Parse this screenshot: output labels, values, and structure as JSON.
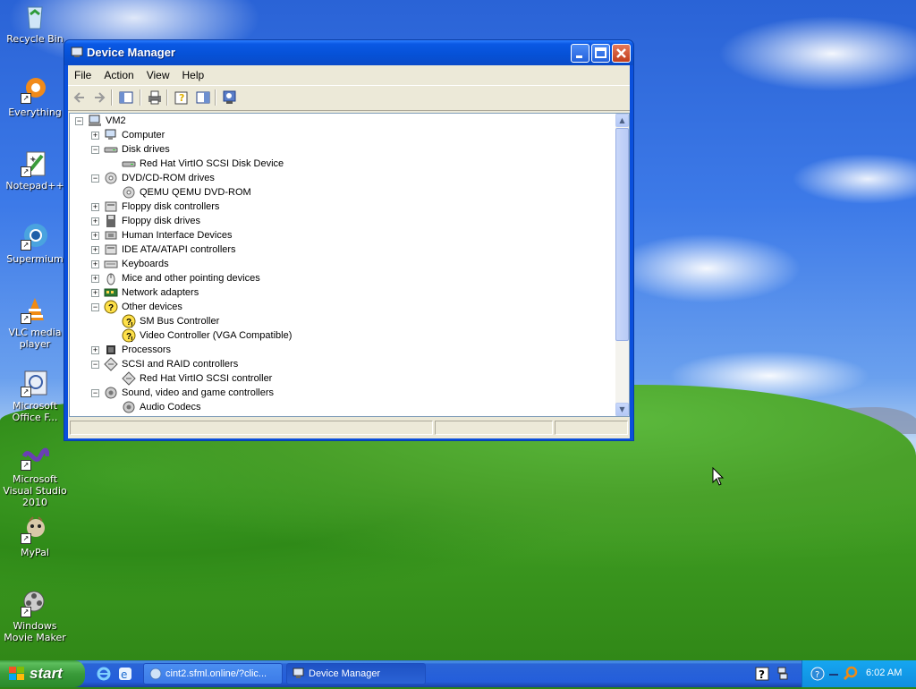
{
  "desktop": {
    "icons": [
      {
        "label": "Recycle Bin",
        "icon": "recycle-bin-icon"
      },
      {
        "label": "Everything",
        "icon": "everything-icon"
      },
      {
        "label": "Notepad++",
        "icon": "notepadpp-icon"
      },
      {
        "label": "Supermium",
        "icon": "supermium-icon"
      },
      {
        "label": "VLC media player",
        "icon": "vlc-icon"
      },
      {
        "label": "Microsoft Office F...",
        "icon": "office-icon"
      },
      {
        "label": "Microsoft Visual Studio 2010",
        "icon": "visual-studio-icon"
      },
      {
        "label": "MyPal",
        "icon": "mypal-icon"
      },
      {
        "label": "Windows Movie Maker",
        "icon": "movie-maker-icon"
      }
    ]
  },
  "window": {
    "title": "Device Manager",
    "menu": [
      "File",
      "Action",
      "View",
      "Help"
    ],
    "toolbar": [
      "back",
      "forward",
      "show-hide-console-tree",
      "print",
      "properties",
      "help",
      "scan-hardware"
    ],
    "tree": {
      "root": "VM2",
      "items": [
        {
          "label": "Computer",
          "expander": "+",
          "level": 1,
          "icon": "computer-icon"
        },
        {
          "label": "Disk drives",
          "expander": "-",
          "level": 1,
          "icon": "disk-drive-icon"
        },
        {
          "label": "Red Hat VirtIO SCSI Disk Device",
          "expander": "",
          "level": 2,
          "icon": "disk-drive-icon"
        },
        {
          "label": "DVD/CD-ROM drives",
          "expander": "-",
          "level": 1,
          "icon": "cdrom-icon"
        },
        {
          "label": "QEMU QEMU DVD-ROM",
          "expander": "",
          "level": 2,
          "icon": "cdrom-icon"
        },
        {
          "label": "Floppy disk controllers",
          "expander": "+",
          "level": 1,
          "icon": "controller-icon"
        },
        {
          "label": "Floppy disk drives",
          "expander": "+",
          "level": 1,
          "icon": "floppy-icon"
        },
        {
          "label": "Human Interface Devices",
          "expander": "+",
          "level": 1,
          "icon": "hid-icon"
        },
        {
          "label": "IDE ATA/ATAPI controllers",
          "expander": "+",
          "level": 1,
          "icon": "controller-icon"
        },
        {
          "label": "Keyboards",
          "expander": "+",
          "level": 1,
          "icon": "keyboard-icon"
        },
        {
          "label": "Mice and other pointing devices",
          "expander": "+",
          "level": 1,
          "icon": "mouse-icon"
        },
        {
          "label": "Network adapters",
          "expander": "+",
          "level": 1,
          "icon": "network-adapter-icon"
        },
        {
          "label": "Other devices",
          "expander": "-",
          "level": 1,
          "icon": "unknown-device-icon"
        },
        {
          "label": "SM Bus Controller",
          "expander": "",
          "level": 2,
          "icon": "warning-device-icon"
        },
        {
          "label": "Video Controller (VGA Compatible)",
          "expander": "",
          "level": 2,
          "icon": "warning-device-icon"
        },
        {
          "label": "Processors",
          "expander": "+",
          "level": 1,
          "icon": "processor-icon"
        },
        {
          "label": "SCSI and RAID controllers",
          "expander": "-",
          "level": 1,
          "icon": "scsi-icon"
        },
        {
          "label": "Red Hat VirtIO SCSI controller",
          "expander": "",
          "level": 2,
          "icon": "scsi-icon"
        },
        {
          "label": "Sound, video and game controllers",
          "expander": "-",
          "level": 1,
          "icon": "sound-icon"
        },
        {
          "label": "Audio Codecs",
          "expander": "",
          "level": 2,
          "icon": "sound-icon"
        }
      ]
    }
  },
  "taskbar": {
    "start_label": "start",
    "tasks": [
      {
        "label": "cint2.sfml.online/?clic...",
        "active": false,
        "icon": "browser-icon"
      },
      {
        "label": "Device Manager",
        "active": true,
        "icon": "device-manager-icon"
      }
    ],
    "clock": "6:02 AM"
  }
}
